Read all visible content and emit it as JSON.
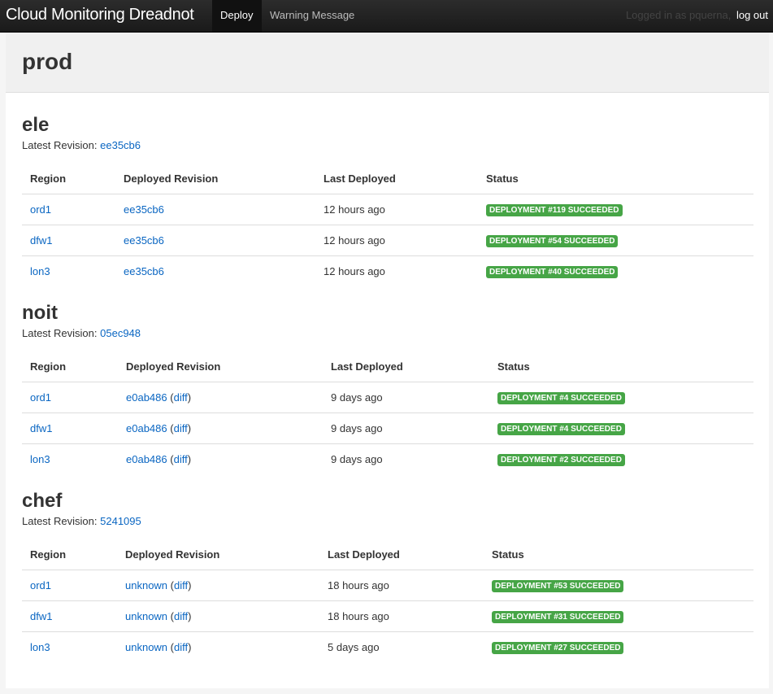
{
  "navbar": {
    "brand": "Cloud Monitoring Dreadnot",
    "items": [
      {
        "label": "Deploy",
        "active": true
      },
      {
        "label": "Warning Message",
        "active": false
      }
    ],
    "logged_in_text": "Logged in as pquerna,",
    "logout_label": "log out"
  },
  "page": {
    "title": "prod"
  },
  "columns": [
    "Region",
    "Deployed Revision",
    "Last Deployed",
    "Status"
  ],
  "stacks": [
    {
      "name": "ele",
      "latest_label": "Latest Revision:",
      "latest_revision": "ee35cb6",
      "rows": [
        {
          "region": "ord1",
          "revision": "ee35cb6",
          "diff": "",
          "last": "12 hours ago",
          "status": "DEPLOYMENT #119 SUCCEEDED"
        },
        {
          "region": "dfw1",
          "revision": "ee35cb6",
          "diff": "",
          "last": "12 hours ago",
          "status": "DEPLOYMENT #54 SUCCEEDED"
        },
        {
          "region": "lon3",
          "revision": "ee35cb6",
          "diff": "",
          "last": "12 hours ago",
          "status": "DEPLOYMENT #40 SUCCEEDED"
        }
      ]
    },
    {
      "name": "noit",
      "latest_label": "Latest Revision:",
      "latest_revision": "05ec948",
      "rows": [
        {
          "region": "ord1",
          "revision": "e0ab486",
          "diff": "diff",
          "last": "9 days ago",
          "status": "DEPLOYMENT #4 SUCCEEDED"
        },
        {
          "region": "dfw1",
          "revision": "e0ab486",
          "diff": "diff",
          "last": "9 days ago",
          "status": "DEPLOYMENT #4 SUCCEEDED"
        },
        {
          "region": "lon3",
          "revision": "e0ab486",
          "diff": "diff",
          "last": "9 days ago",
          "status": "DEPLOYMENT #2 SUCCEEDED"
        }
      ]
    },
    {
      "name": "chef",
      "latest_label": "Latest Revision:",
      "latest_revision": "5241095",
      "rows": [
        {
          "region": "ord1",
          "revision": "unknown",
          "diff": "diff",
          "last": "18 hours ago",
          "status": "DEPLOYMENT #53 SUCCEEDED"
        },
        {
          "region": "dfw1",
          "revision": "unknown",
          "diff": "diff",
          "last": "18 hours ago",
          "status": "DEPLOYMENT #31 SUCCEEDED"
        },
        {
          "region": "lon3",
          "revision": "unknown",
          "diff": "diff",
          "last": "5 days ago",
          "status": "DEPLOYMENT #27 SUCCEEDED"
        }
      ]
    }
  ],
  "colors": {
    "success": "#46a546",
    "link": "#0a66c2",
    "navbar": "#1a1a1a"
  }
}
